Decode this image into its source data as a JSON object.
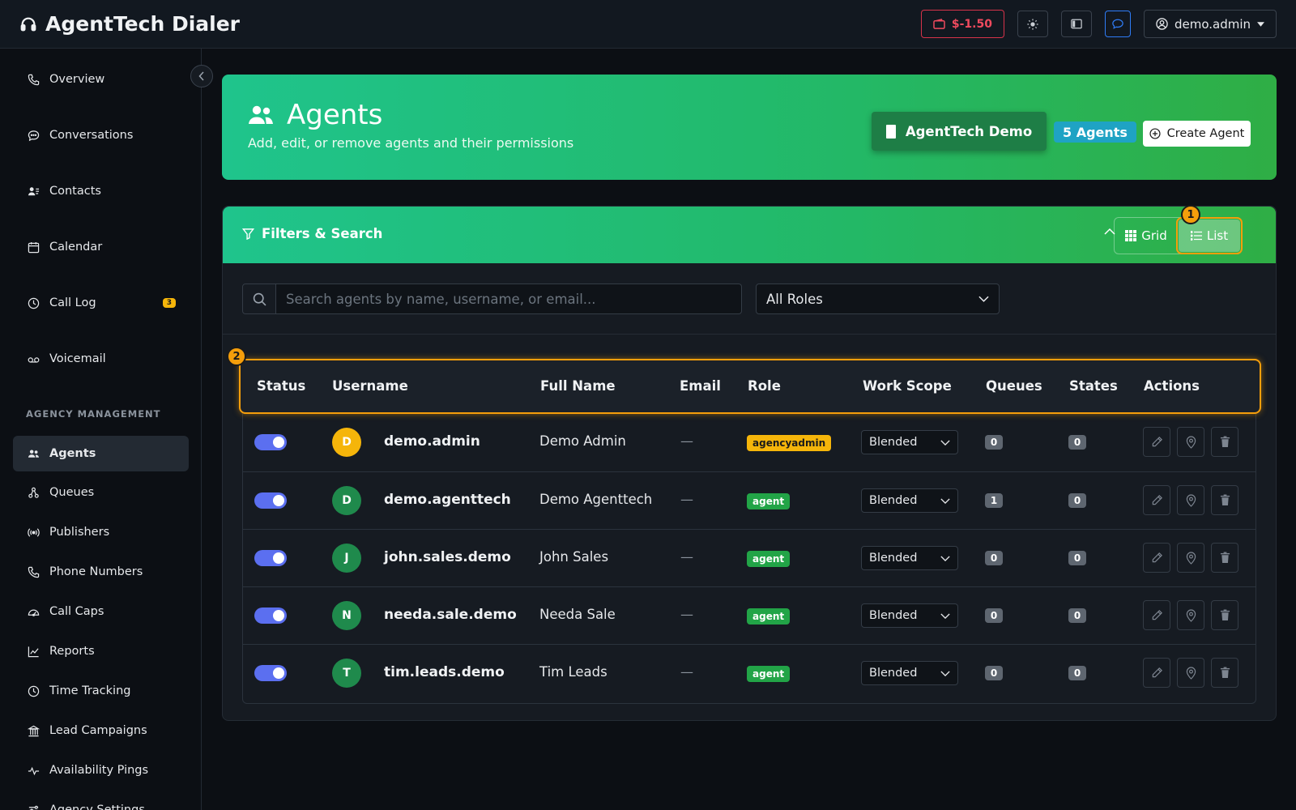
{
  "app": {
    "title": "AgentTech Dialer"
  },
  "topbar": {
    "balance": "$-1.50",
    "user": "demo.admin"
  },
  "sidebar": {
    "items": [
      {
        "label": "Overview",
        "icon": "phone-icon"
      },
      {
        "label": "Conversations",
        "icon": "chat-icon"
      },
      {
        "label": "Contacts",
        "icon": "contacts-icon"
      },
      {
        "label": "Calendar",
        "icon": "calendar-icon"
      },
      {
        "label": "Call Log",
        "icon": "clock-icon",
        "badge": "3"
      },
      {
        "label": "Voicemail",
        "icon": "voicemail-icon"
      }
    ],
    "section_label": "AGENCY MANAGEMENT",
    "management_items": [
      {
        "label": "Agents",
        "icon": "people-icon",
        "active": true
      },
      {
        "label": "Queues",
        "icon": "queue-icon"
      },
      {
        "label": "Publishers",
        "icon": "broadcast-icon"
      },
      {
        "label": "Phone Numbers",
        "icon": "phone-icon"
      },
      {
        "label": "Call Caps",
        "icon": "gauge-icon"
      },
      {
        "label": "Reports",
        "icon": "chart-icon"
      },
      {
        "label": "Time Tracking",
        "icon": "clock-icon"
      },
      {
        "label": "Lead Campaigns",
        "icon": "building-icon"
      },
      {
        "label": "Availability Pings",
        "icon": "pulse-icon"
      },
      {
        "label": "Agency Settings",
        "icon": "settings-icon"
      }
    ]
  },
  "header": {
    "title": "Agents",
    "subtitle": "Add, edit, or remove agents and their permissions",
    "company": "AgentTech Demo",
    "count": "5 Agents",
    "create_label": "Create Agent"
  },
  "filters": {
    "title": "Filters & Search",
    "grid_label": "Grid",
    "list_label": "List",
    "search_placeholder": "Search agents by name, username, or email...",
    "role_value": "All Roles"
  },
  "markers": {
    "m1": "1",
    "m2": "2"
  },
  "table": {
    "columns": [
      "Status",
      "Username",
      "Full Name",
      "Email",
      "Role",
      "Work Scope",
      "Queues",
      "States",
      "Actions"
    ],
    "rows": [
      {
        "initial": "D",
        "avatar_color": "#f5b50a",
        "username": "demo.admin",
        "full_name": "Demo Admin",
        "email": "—",
        "role": "agencyadmin",
        "role_color": "#f5b50a",
        "scope": "Blended",
        "queues": "0",
        "states": "0"
      },
      {
        "initial": "D",
        "avatar_color": "#1f8a4c",
        "username": "demo.agenttech",
        "full_name": "Demo Agenttech",
        "email": "—",
        "role": "agent",
        "role_color": "#22a447",
        "scope": "Blended",
        "queues": "1",
        "states": "0"
      },
      {
        "initial": "J",
        "avatar_color": "#1f8a4c",
        "username": "john.sales.demo",
        "full_name": "John Sales",
        "email": "—",
        "role": "agent",
        "role_color": "#22a447",
        "scope": "Blended",
        "queues": "0",
        "states": "0"
      },
      {
        "initial": "N",
        "avatar_color": "#1f8a4c",
        "username": "needa.sale.demo",
        "full_name": "Needa Sale",
        "email": "—",
        "role": "agent",
        "role_color": "#22a447",
        "scope": "Blended",
        "queues": "0",
        "states": "0"
      },
      {
        "initial": "T",
        "avatar_color": "#1f8a4c",
        "username": "tim.leads.demo",
        "full_name": "Tim Leads",
        "email": "—",
        "role": "agent",
        "role_color": "#22a447",
        "scope": "Blended",
        "queues": "0",
        "states": "0"
      }
    ]
  }
}
